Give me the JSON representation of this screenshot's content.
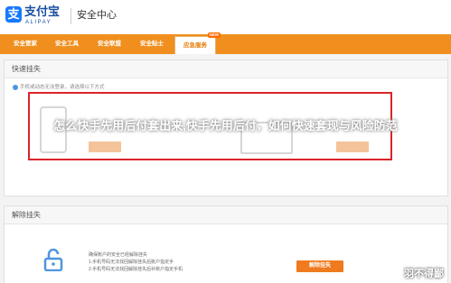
{
  "header": {
    "logo_text": "支付宝",
    "logo_sub": "ALIPAY",
    "logo_glyph": "支",
    "site_title": "安全中心"
  },
  "nav": {
    "items": [
      {
        "label": "安全管家"
      },
      {
        "label": "安全工具"
      },
      {
        "label": "安全联盟"
      },
      {
        "label": "安全贴士"
      },
      {
        "label": "应急服务",
        "active": true,
        "badge": "NEW"
      }
    ]
  },
  "quick_freeze": {
    "title": "快速挂失",
    "notice": "手机或动态无法登录，请选择以下方式"
  },
  "overlay_title": "怎么快手先用后付套出来,快手先用后付，如何快速套现与风险防范",
  "unlock": {
    "title": "解除挂失",
    "desc_lines": [
      "确保账户的安全已经解除挂失",
      "1.手机号码无法找回解除挂失后账户指定手",
      "2.手机号码无法找回解除挂失后补账户指定手机"
    ],
    "button_label": "解除挂失"
  },
  "corner_watermark": "羽不得鄙",
  "colors": {
    "nav_orange": "#f08f1e",
    "highlight_red": "#d9242a",
    "button_orange": "#f07a1e",
    "brand_blue": "#1678ff"
  }
}
